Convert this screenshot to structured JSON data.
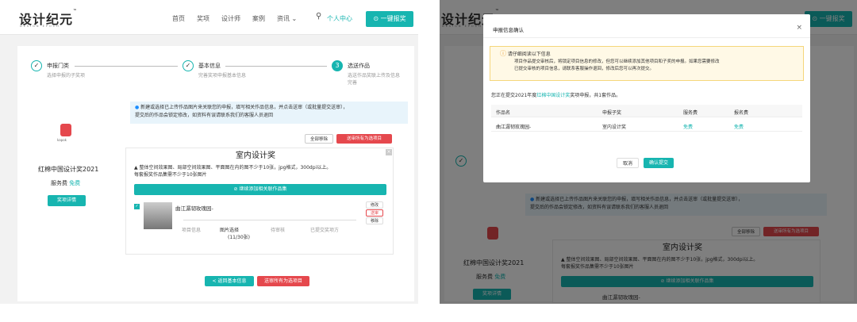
{
  "colors": {
    "accent": "#17b5b0",
    "danger": "#e5484d",
    "notice_bg": "#fff9e6",
    "notice_border": "#f5d67b",
    "info": "#1a8cff"
  },
  "header": {
    "logo": "设计纪元",
    "logo_tm": "™",
    "logo_sub": "DESIGN EPOCH",
    "nav": [
      "首页",
      "奖项",
      "设计师",
      "案例",
      "资讯 ⌄"
    ],
    "user_center": "个人中心",
    "submit_btn": "一键报奖",
    "search_icon": "search-icon"
  },
  "steps": [
    {
      "title": "申报门类",
      "desc": "选择申报的子奖项",
      "num": "✓"
    },
    {
      "title": "基本信息",
      "desc": "完善奖项申报基本信息",
      "num": "✓"
    },
    {
      "title": "选送作品",
      "desc": "选送作品奖联上传及信息完善",
      "num": "3"
    }
  ],
  "award": {
    "logo_text": "kapok",
    "logo_sub": "DESIGN",
    "name": "红棉中国设计奖2021",
    "fee_label": "服务费",
    "fee_value": "免费",
    "detail_btn": "奖项详情"
  },
  "notice": "新建或选择已上传作品图片来关联您的申报，填写相关作品信息，并点击送审（或批量提交送审），提交后的作品会锁定修改，如您对有需要联系我们的客服人员退回",
  "notice_line1": "新建或选择已上传作品图片来关联您的申报，填写相关作品信息，并点击送审（或批量提交送审），",
  "notice_line2": "提交后的作品会锁定修改，如资料有误请联系我们的客服人员退回",
  "actions": {
    "remove_all": "全部移除",
    "submit_all": "送审所有为选项目"
  },
  "sub_award": {
    "title": "室内设计奖",
    "req_line1": "整体空间效果图、局部空间效果图、平面图在内的图不少于10张，jpg格式，300dpi以上。",
    "req_line2": "每套报奖作品集需不少于10张图片",
    "add_btn": "继续添加相关联作品集"
  },
  "work": {
    "name": "曲江潺韧玫瑰园-",
    "stages": [
      "项目信息",
      "图片选择",
      "待审核",
      "已提交奖项方"
    ],
    "img_count": "(11/30张)",
    "ops": [
      "修改",
      "送审",
      "移除"
    ]
  },
  "bottom": {
    "back": "< 返回基本信息",
    "submit": "送审所有为选项目"
  },
  "modal": {
    "title": "申报信息确认",
    "close": "×",
    "warn_title": "请仔细阅读以下信息",
    "warn_line1": "项目作品提交审核后，将锁定项目信息的修改，但您可以继续添加其他项目和子奖的申报。如果您需要修改",
    "warn_line2": "已提交审核的项目信息，请联系客服操作退回，修改后您可以再次提交。",
    "intro_prefix": "您正在提交2021年度",
    "intro_award": "红棉中国设计奖",
    "intro_suffix": "奖项申报，共1套作品。",
    "cols": [
      "作品名",
      "申报子奖",
      "服务费",
      "报名费"
    ],
    "row": [
      "曲江潺韧玫瑰园-",
      "室内设计奖",
      "免费",
      "免费"
    ],
    "cancel": "取消",
    "confirm": "确认提交"
  }
}
